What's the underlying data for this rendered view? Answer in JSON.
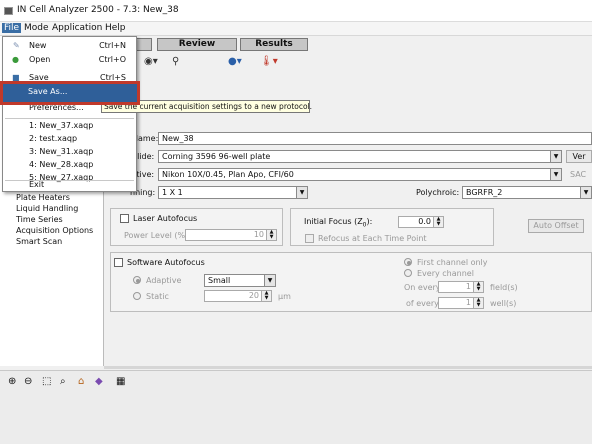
{
  "window": {
    "title": "IN Cell Analyzer 2500 - 7.3: New_38"
  },
  "menubar": {
    "items": [
      "File",
      "Mode",
      "Application",
      "Help"
    ]
  },
  "tabs": [
    {
      "label": "Review"
    },
    {
      "label": "Results"
    }
  ],
  "file_menu": {
    "items": [
      {
        "label": "New",
        "shortcut": "Ctrl+N"
      },
      {
        "label": "Open",
        "shortcut": "Ctrl+O"
      },
      {
        "label": "Save",
        "shortcut": "Ctrl+S"
      },
      {
        "label": "Save As..."
      },
      {
        "label": "Preferences..."
      },
      {
        "label": "1: New_37.xaqp"
      },
      {
        "label": "2: test.xaqp"
      },
      {
        "label": "3: New_31.xaqp"
      },
      {
        "label": "4: New_28.xaqp"
      },
      {
        "label": "5: New_27.xaqp"
      },
      {
        "label": "Exit"
      }
    ]
  },
  "tooltip": {
    "text": "Save the current acquisition settings to a new protocol."
  },
  "left_nav": {
    "items": [
      "Plate Heaters",
      "Liquid Handling",
      "Time Series",
      "Acquisition Options",
      "Smart Scan"
    ]
  },
  "form": {
    "name_label": "Name:",
    "name_value": "New_38",
    "slide_label": "Slide:",
    "slide_value": "Corning 3596 96-well plate",
    "slide_button": "Ver",
    "objective_label": "ctive:",
    "objective_value": "Nikon 10X/0.45, Plan Apo, CFI/60",
    "sac_label": "SAC",
    "binning_label": "nning:",
    "binning_value": "1 X 1",
    "polychroic_label": "Polychroic:",
    "polychroic_value": "BGRFR_2"
  },
  "laser_autofocus": {
    "label": "Laser Autofocus",
    "power_label": "Power Level (%):",
    "power_value": "10",
    "initial_focus_label": "Initial Focus (Z",
    "initial_focus_sub": "0",
    "initial_focus_suffix": "):",
    "initial_focus_value": "0.0",
    "refocus_label": "Refocus at Each Time Point",
    "auto_offset_label": "Auto Offset"
  },
  "software_autofocus": {
    "label": "Software Autofocus",
    "adaptive_label": "Adaptive",
    "adaptive_value": "Small",
    "static_label": "Static",
    "static_value": "20",
    "static_unit": "µm",
    "first_channel_label": "First channel only",
    "every_channel_label": "Every channel",
    "on_every_label": "On every",
    "on_every_value": "1",
    "fields_label": "field(s)",
    "of_every_label": "of every",
    "of_every_value": "1",
    "wells_label": "well(s)"
  }
}
